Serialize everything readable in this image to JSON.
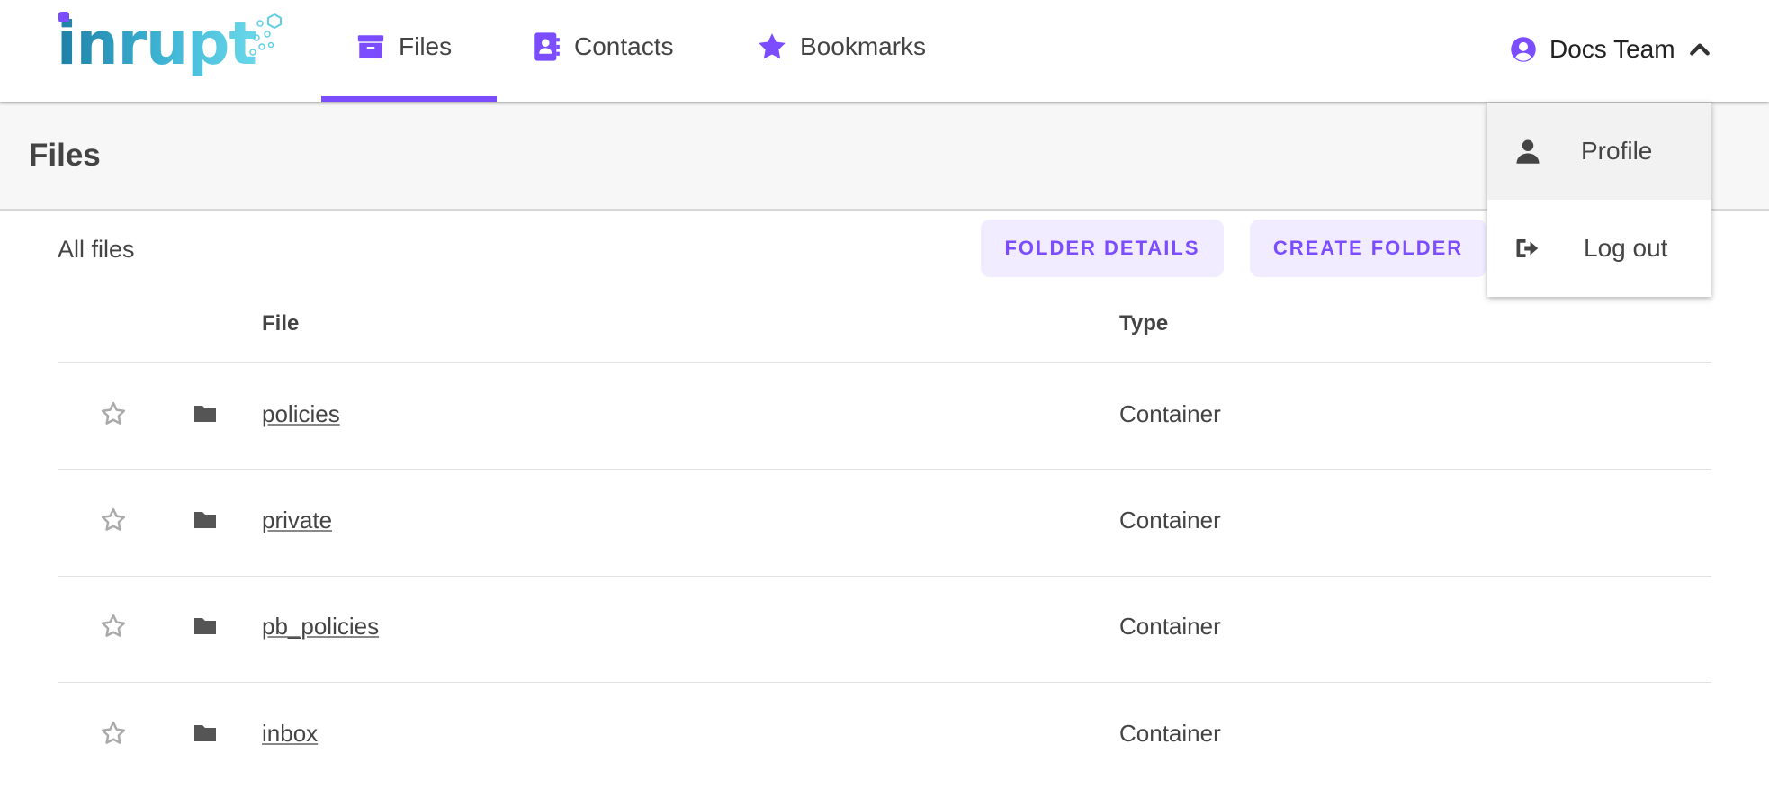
{
  "brand": {
    "logo_text": "inrupt"
  },
  "nav": {
    "tabs": [
      {
        "label": "Files",
        "icon": "archive-box-icon",
        "active": true
      },
      {
        "label": "Contacts",
        "icon": "address-book-icon",
        "active": false
      },
      {
        "label": "Bookmarks",
        "icon": "star-icon",
        "active": false
      }
    ],
    "user": {
      "name": "Docs Team",
      "icon": "user-circle-icon"
    }
  },
  "user_dropdown": {
    "items": [
      {
        "label": "Profile",
        "icon": "user-icon"
      },
      {
        "label": "Log out",
        "icon": "sign-out-icon"
      }
    ]
  },
  "page": {
    "title": "Files"
  },
  "toolbar": {
    "breadcrumb": "All files",
    "folder_details_label": "FOLDER DETAILS",
    "create_folder_label": "CREATE FOLDER"
  },
  "table": {
    "columns": {
      "file": "File",
      "type": "Type"
    },
    "rows": [
      {
        "name": "policies",
        "type": "Container"
      },
      {
        "name": "private",
        "type": "Container"
      },
      {
        "name": "pb_policies",
        "type": "Container"
      },
      {
        "name": "inbox",
        "type": "Container"
      }
    ]
  },
  "colors": {
    "accent": "#7c4dff",
    "accent_light": "#f1ecff",
    "text": "#444444"
  }
}
